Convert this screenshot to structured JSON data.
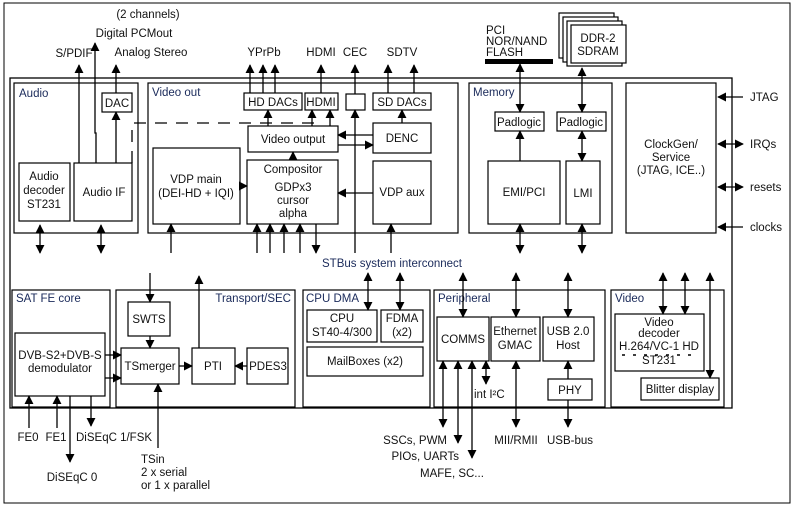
{
  "top_labels": {
    "two_channels": "(2 channels)",
    "digital_pcmout": "Digital PCMout",
    "spdif": "S/PDIF",
    "analog_stereo": "Analog Stereo",
    "yprpb": "YPrPb",
    "hdmi": "HDMI",
    "cec": "CEC",
    "sdtv": "SDTV",
    "flash": [
      "PCI",
      "NOR/NAND",
      "FLASH"
    ],
    "ddr": [
      "DDR-2",
      "SDRAM"
    ]
  },
  "audio": {
    "title": "Audio",
    "dac": "DAC",
    "decoder": [
      "Audio",
      "decoder",
      "ST231"
    ],
    "audio_if": "Audio IF"
  },
  "video_out": {
    "title": "Video out",
    "hd_dacs": "HD DACs",
    "hdmi": "HDMI",
    "sd_dacs": "SD DACs",
    "video_output": "Video output",
    "denc": "DENC",
    "vdp_main": [
      "VDP main",
      "(DEI-HD + IQI)"
    ],
    "compositor": [
      "Compositor",
      "GDPx3",
      "cursor",
      "alpha"
    ],
    "vdp_aux": "VDP aux"
  },
  "memory": {
    "title": "Memory",
    "padlogic": "Padlogic",
    "emi_pci": "EMI/PCI",
    "lmi": "LMI"
  },
  "clockgen": {
    "lines": [
      "ClockGen/",
      "Service",
      "(JTAG, ICE..)"
    ]
  },
  "right_labels": {
    "jtag": "JTAG",
    "irqs": "IRQs",
    "resets": "resets",
    "clocks": "clocks"
  },
  "bus": "STBus system interconnect",
  "sat_fe": {
    "title": "SAT FE core",
    "demod": [
      "DVB-S2+DVB-S",
      "demodulator"
    ]
  },
  "transport": {
    "title": "Transport/SEC",
    "swts": "SWTS",
    "tsmerger": "TSmerger",
    "pti": "PTI",
    "pdes3": "PDES3"
  },
  "cpu_dma": {
    "title": "CPU DMA",
    "cpu": [
      "CPU",
      "ST40-4/300"
    ],
    "fdma": [
      "FDMA",
      "(x2)"
    ],
    "mailboxes": "MailBoxes (x2)"
  },
  "peripheral": {
    "title": "Peripheral",
    "comms": "COMMS",
    "ethernet": [
      "Ethernet",
      "GMAC"
    ],
    "usb": [
      "USB 2.0",
      "Host"
    ],
    "phy": "PHY",
    "int_i2c": "int I²C"
  },
  "video": {
    "title": "Video",
    "decoder": [
      "Video",
      "decoder",
      "H.264/VC-1 HD",
      "ST231"
    ],
    "blitter": "Blitter display"
  },
  "bottom_labels": {
    "fe0": "FE0",
    "fe1": "FE1",
    "diseqc1": "DiSEqC 1/FSK",
    "diseqc0": "DiSEqC 0",
    "tsin": [
      "TSin",
      "2 x serial",
      "or 1 x parallel"
    ],
    "sscs": "SSCs, PWM",
    "pios": "PIOs, UARTs",
    "mafe": "MAFE, SC...",
    "mii": "MII/RMII",
    "usb_bus": "USB-bus"
  }
}
